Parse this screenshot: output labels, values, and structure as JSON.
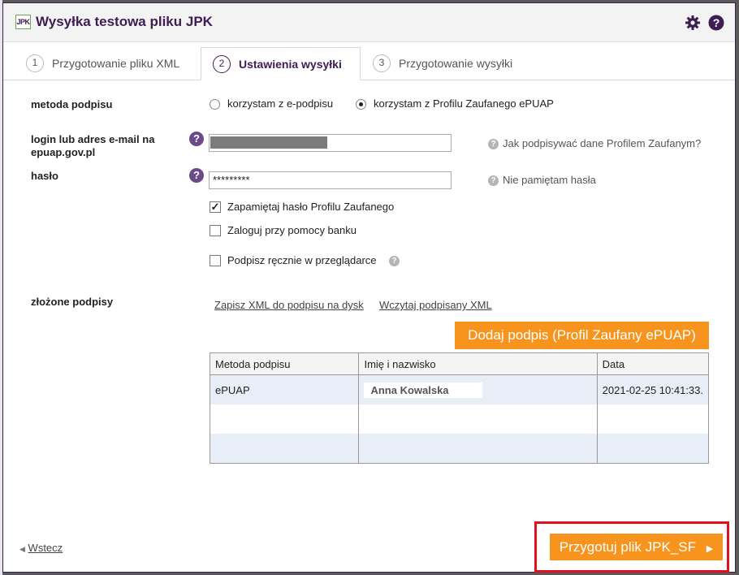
{
  "dialog": {
    "logo_text": "JPK",
    "title": "Wysyłka testowa pliku JPK",
    "icons": [
      "gear-icon",
      "help-icon"
    ]
  },
  "tabs": [
    {
      "num": "1",
      "label": "Przygotowanie pliku XML",
      "active": false
    },
    {
      "num": "2",
      "label": "Ustawienia wysyłki",
      "active": true
    },
    {
      "num": "3",
      "label": "Przygotowanie wysyłki",
      "active": false
    }
  ],
  "form": {
    "method_label": "metoda podpisu",
    "method_options": [
      {
        "label": "korzystam z e-podpisu",
        "checked": false
      },
      {
        "label": "korzystam z Profilu Zaufanego ePUAP",
        "checked": true
      }
    ],
    "login_label": "login lub adres e-mail na epuap.gov.pl",
    "login_help_link": "Jak podpisywać dane Profilem Zaufanym?",
    "password_label": "hasło",
    "password_value": "*********",
    "password_help_link": "Nie pamiętam hasła",
    "checkboxes": [
      {
        "label": "Zapamiętaj hasło Profilu Zaufanego",
        "checked": true
      },
      {
        "label": "Zaloguj przy pomocy banku",
        "checked": false
      },
      {
        "label": "Podpisz ręcznie w przeglądarce",
        "checked": false
      }
    ]
  },
  "signatures": {
    "label": "złożone podpisy",
    "save_link": "Zapisz XML do podpisu na dysk",
    "load_link": "Wczytaj podpisany XML",
    "add_button": "Dodaj podpis (Profil Zaufany ePUAP)",
    "columns": [
      "Metoda podpisu",
      "Imię i nazwisko",
      "Data"
    ],
    "rows": [
      {
        "method": "ePUAP",
        "name": "Anna Kowalska",
        "date": "2021-02-25 10:41:33."
      }
    ]
  },
  "footer": {
    "back_label": "Wstecz",
    "next_label": "Przygotuj plik JPK_SF",
    "colors": {
      "accent": "#f7941d",
      "brand": "#3d1d52",
      "highlight": "#e0101f"
    }
  }
}
